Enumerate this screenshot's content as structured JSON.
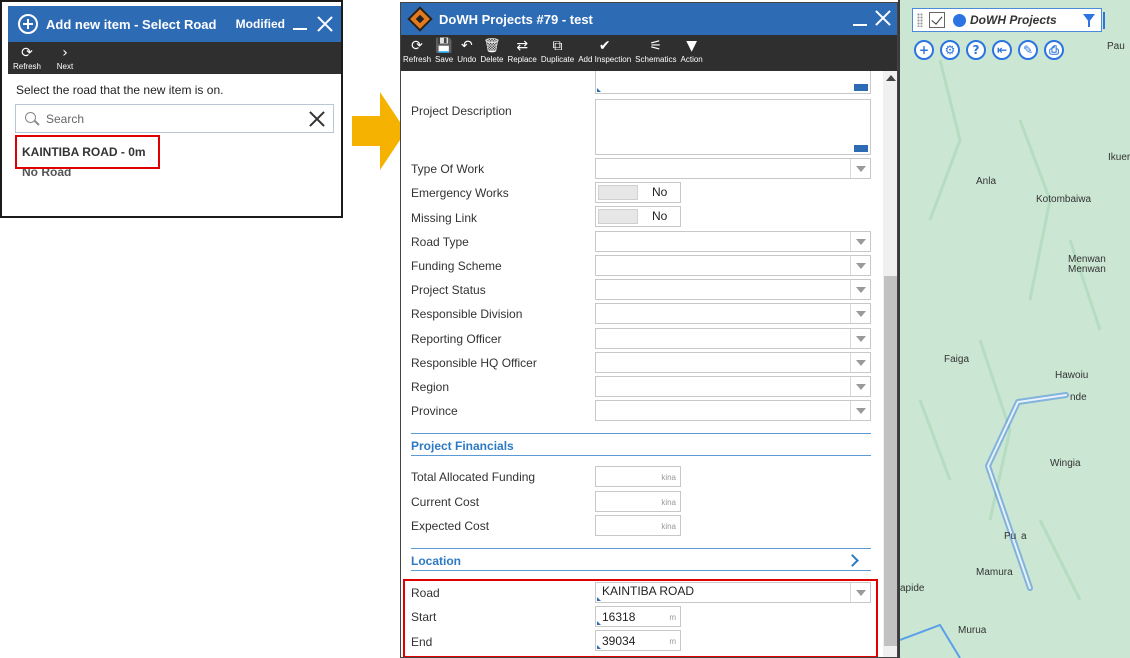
{
  "left_panel": {
    "title": "Add new item - Select Road",
    "status": "Modified",
    "toolbar": [
      {
        "label": "Refresh",
        "glyph": "⟳"
      },
      {
        "label": "Next",
        "glyph": "›"
      }
    ],
    "instruction": "Select the road that the new item is on.",
    "search": {
      "placeholder": "Search",
      "value": ""
    },
    "roads": [
      "KAINTIBA ROAD - 0m",
      "No Road"
    ]
  },
  "form": {
    "title": "DoWH Projects #79 - test",
    "toolbar": [
      {
        "label": "Refresh",
        "glyph": "⟳"
      },
      {
        "label": "Save",
        "glyph": "💾"
      },
      {
        "label": "Undo",
        "glyph": "↶"
      },
      {
        "label": "Delete",
        "glyph": "🗑"
      },
      {
        "label": "Replace",
        "glyph": "⇄"
      },
      {
        "label": "Duplicate",
        "glyph": "⧉"
      },
      {
        "label": "Add Inspection",
        "glyph": "✔"
      },
      {
        "label": "Schematics",
        "glyph": "⚟"
      },
      {
        "label": "Action",
        "glyph": "▼"
      }
    ],
    "fields": {
      "project_description": "Project Description",
      "type_of_work": "Type Of Work",
      "emergency_works": {
        "label": "Emergency Works",
        "value": "No"
      },
      "missing_link": {
        "label": "Missing Link",
        "value": "No"
      },
      "road_type": "Road Type",
      "funding_scheme": "Funding Scheme",
      "project_status": "Project Status",
      "responsible_division": "Responsible Division",
      "reporting_officer": "Reporting Officer",
      "responsible_hq_officer": "Responsible HQ Officer",
      "region": "Region",
      "province": "Province"
    },
    "financials": {
      "heading": "Project Financials",
      "unit": "kina",
      "total_allocated_funding": "Total Allocated Funding",
      "current_cost": "Current Cost",
      "expected_cost": "Expected Cost"
    },
    "location": {
      "heading": "Location",
      "road": {
        "label": "Road",
        "value": "KAINTIBA ROAD"
      },
      "start": {
        "label": "Start",
        "value": "16318",
        "unit": "m"
      },
      "end": {
        "label": "End",
        "value": "39034",
        "unit": "m"
      }
    }
  },
  "map": {
    "layer_name": "DoWH Projects",
    "layer_color": "#2b74e2",
    "tools": [
      "add-icon",
      "settings-icon",
      "help-icon",
      "back-icon",
      "ruler-icon",
      "print-icon"
    ],
    "places": [
      "Pau",
      "Ikuer",
      "Anla",
      "Kotombaiwa",
      "Menwan",
      "Menwan",
      "Faiga",
      "Hawoiu",
      "nde",
      "Wingia",
      "Pu",
      "a",
      "Mamura",
      "apide",
      "Murua"
    ]
  }
}
